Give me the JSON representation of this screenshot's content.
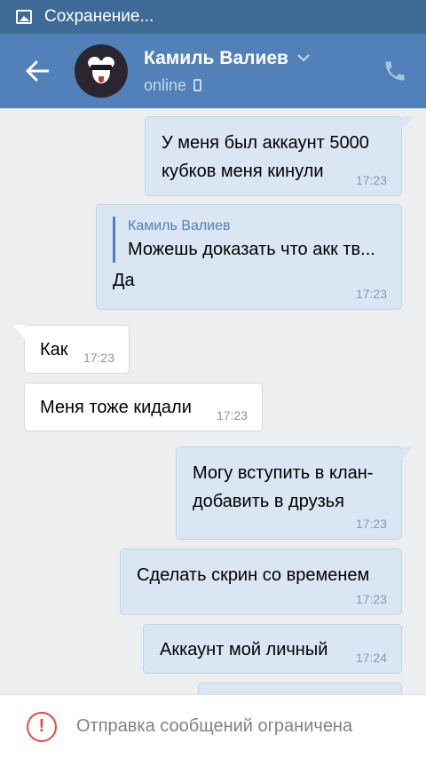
{
  "status_bar": {
    "text": "Сохранение...",
    "icon": "image-icon"
  },
  "header": {
    "back_icon": "back-arrow-icon",
    "contact_name": "Камиль Валиев",
    "presence": "online",
    "call_icon": "phone-icon"
  },
  "messages": [
    {
      "direction": "out",
      "lines": [
        "У меня был аккаунт 5000",
        "кубков меня кинули"
      ],
      "time": "17:23"
    },
    {
      "direction": "out",
      "reply_to": {
        "name": "Камиль Валиев",
        "text": "Можешь доказать что акк тв..."
      },
      "text": "Да",
      "time": "17:23"
    },
    {
      "direction": "in",
      "text": "Как",
      "time": "17:23"
    },
    {
      "direction": "in",
      "text": "Меня тоже кидали",
      "time": "17:23"
    },
    {
      "direction": "out",
      "lines": [
        "Могу вступить в клан-",
        "добавить в друзья"
      ],
      "time": "17:23"
    },
    {
      "direction": "out",
      "text": "Сделать скрин со временем",
      "time": "17:23"
    },
    {
      "direction": "out",
      "text": "Аккаунт мой личный",
      "time": "17:24"
    }
  ],
  "footer": {
    "notice": "Отправка сообщений ограничена",
    "icon": "alert-circle-icon"
  },
  "colors": {
    "header": "#5181b8",
    "status_bar": "#3f6a98",
    "outgoing_bubble": "#dae6f4",
    "incoming_bubble": "#ffffff",
    "alert": "#e64646"
  }
}
